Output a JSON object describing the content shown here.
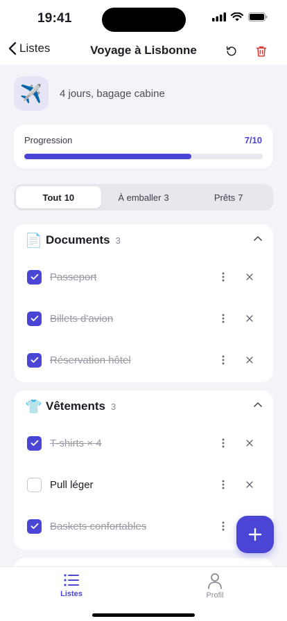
{
  "status_bar": {
    "time": "19:41"
  },
  "nav": {
    "back_label": "Listes",
    "title": "Voyage à Lisbonne",
    "reset_icon": "reset-icon",
    "delete_icon": "trash-icon"
  },
  "summary": {
    "emoji": "✈️",
    "text": "4 jours, bagage cabine"
  },
  "progress": {
    "label": "Progression",
    "value": "7/10",
    "fraction": 0.7
  },
  "colors": {
    "accent": "#4b45d6",
    "danger": "#d63a3a",
    "background": "#f3f4f8"
  },
  "filter_tabs": [
    {
      "label": "Tout",
      "count": "10",
      "active": true
    },
    {
      "label": "À emballer",
      "count": "3",
      "active": false
    },
    {
      "label": "Prêts",
      "count": "7",
      "active": false
    }
  ],
  "sections": [
    {
      "emoji": "📄",
      "title": "Documents",
      "count": "3",
      "items": [
        {
          "label": "Passeport",
          "checked": true
        },
        {
          "label": "Billets d'avion",
          "checked": true
        },
        {
          "label": "Réservation hôtel",
          "checked": true
        }
      ]
    },
    {
      "emoji": "👕",
      "title": "Vêtements",
      "count": "3",
      "items": [
        {
          "label": "T-shirts × 4",
          "checked": true
        },
        {
          "label": "Pull léger",
          "checked": false
        },
        {
          "label": "Baskets confortables",
          "checked": true
        }
      ]
    }
  ],
  "fab": {
    "icon": "plus-icon"
  },
  "tab_bar": [
    {
      "label": "Listes",
      "icon": "list-icon",
      "active": true
    },
    {
      "label": "Profil",
      "icon": "person-icon",
      "active": false
    }
  ]
}
